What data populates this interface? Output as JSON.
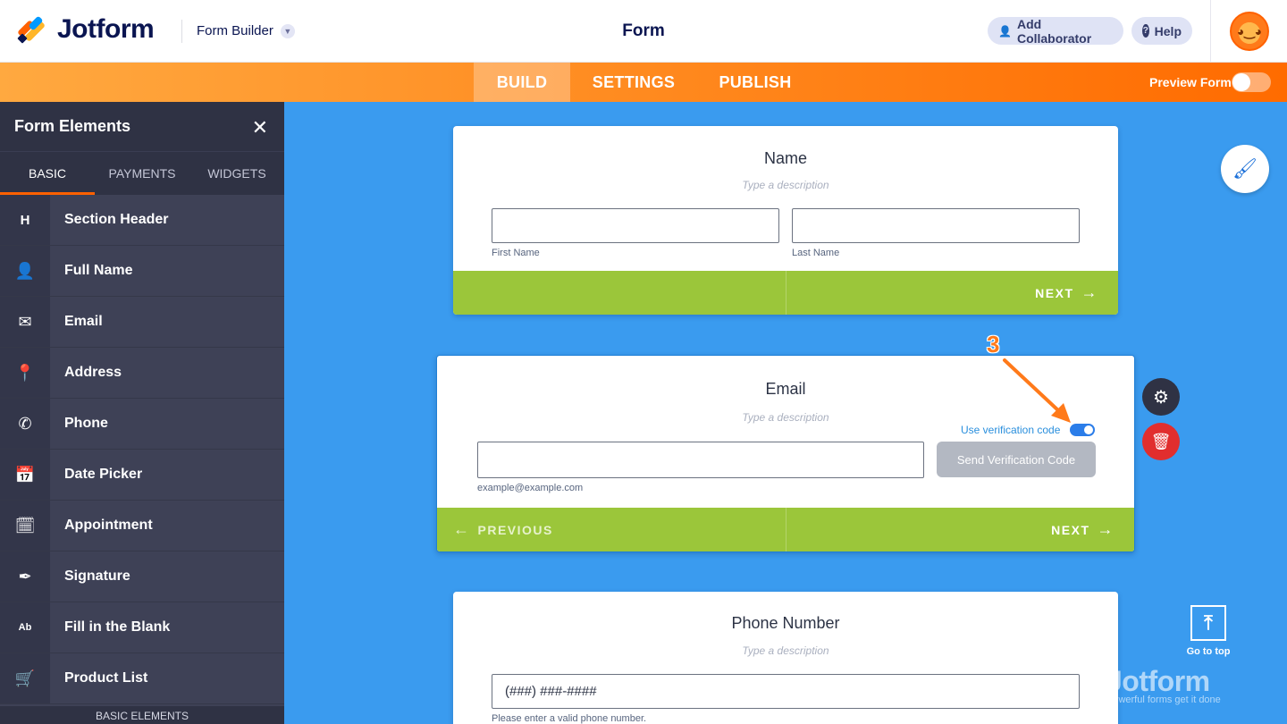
{
  "header": {
    "brand": "Jotform",
    "builder_label": "Form Builder",
    "center_title": "Form",
    "add_collaborator": "Add Collaborator",
    "help": "Help"
  },
  "nav": {
    "tabs": [
      "BUILD",
      "SETTINGS",
      "PUBLISH"
    ],
    "active_tab": "BUILD",
    "preview_label": "Preview Form"
  },
  "sidebar": {
    "title": "Form Elements",
    "tabs": [
      "BASIC",
      "PAYMENTS",
      "WIDGETS"
    ],
    "items": [
      {
        "label": "Section Header",
        "icon": "H"
      },
      {
        "label": "Full Name",
        "icon": "👤"
      },
      {
        "label": "Email",
        "icon": "✉"
      },
      {
        "label": "Address",
        "icon": "📍"
      },
      {
        "label": "Phone",
        "icon": "✆"
      },
      {
        "label": "Date Picker",
        "icon": "📅"
      },
      {
        "label": "Appointment",
        "icon": "🗓"
      },
      {
        "label": "Signature",
        "icon": "✒"
      },
      {
        "label": "Fill in the Blank",
        "icon": "Ab"
      },
      {
        "label": "Product List",
        "icon": "🛒"
      }
    ],
    "footer": "BASIC ELEMENTS"
  },
  "card_name": {
    "title": "Name",
    "description": "Type a description",
    "first_label": "First Name",
    "last_label": "Last Name",
    "next": "NEXT"
  },
  "card_email": {
    "title": "Email",
    "description": "Type a description",
    "verification_label": "Use verification code",
    "send_button": "Send Verification Code",
    "sublabel": "example@example.com",
    "previous": "PREVIOUS",
    "next": "NEXT"
  },
  "card_phone": {
    "title": "Phone Number",
    "description": "Type a description",
    "value": "(###) ###-####",
    "sublabel": "Please enter a valid phone number."
  },
  "annotation": {
    "step": "3"
  },
  "go_to_top": "Go to top",
  "watermark": {
    "title": "Jotform",
    "subtitle": "Powerful forms get it done"
  },
  "colors": {
    "accent": "#ff6100",
    "canvas": "#3a9bef",
    "footer_green": "#9bc63a",
    "toggle_on": "#2b7de9"
  }
}
